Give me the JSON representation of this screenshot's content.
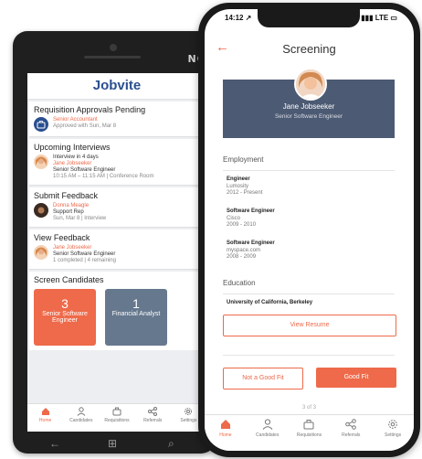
{
  "colors": {
    "accent": "#ee6a4a",
    "brand_blue": "#2a4f91",
    "profile_bg": "#4c5a73",
    "tile_gray": "#66788e"
  },
  "winphone": {
    "brand": "NO",
    "app_title": "Jobvite",
    "cards": [
      {
        "title": "Requisition Approvals Pending",
        "line1": "Senior Accountant",
        "line2": "Approved with Sun, Mar 8"
      },
      {
        "title": "Upcoming Interviews",
        "line1": "Interview in 4 days",
        "line2": "Jane Jobseeker",
        "line3": "Senior Software Engineer",
        "line4": "10:15 AM – 11:15 AM | Conference Room"
      },
      {
        "title": "Submit Feedback",
        "line1": "Donna Meagle",
        "line2": "Support Rep",
        "line3": "Sun, Mar 8 | Interview"
      },
      {
        "title": "View Feedback",
        "line1": "Jane Jobseeker",
        "line2": "Senior Software Engineer",
        "line3": "1 completed | 4 remaining"
      }
    ],
    "screen_candidates": {
      "title": "Screen Candidates",
      "tiles": [
        {
          "count": "3",
          "label": "Senior Software Engineer"
        },
        {
          "count": "1",
          "label": "Financial Analyst"
        }
      ]
    },
    "tabs": [
      "Home",
      "Candidates",
      "Requisitions",
      "Referrals",
      "Settings"
    ],
    "nav": {
      "back": "←",
      "windows": "⊞",
      "search": "⌕"
    }
  },
  "iphone": {
    "status": {
      "time": "14:12 ↗",
      "signal": "▮▮▮ LTE ▭"
    },
    "header": {
      "back_icon": "←",
      "title": "Screening"
    },
    "profile": {
      "name": "Jane Jobseeker",
      "title": "Senior Software Engineer"
    },
    "employment": {
      "heading": "Employment",
      "jobs": [
        {
          "title": "Engineer",
          "company": "Lumosity",
          "dates": "2012 - Present"
        },
        {
          "title": "Software Engineer",
          "company": "Cisco",
          "dates": "2009 - 2010"
        },
        {
          "title": "Software Engineer",
          "company": "myspace.com",
          "dates": "2008 - 2009"
        }
      ]
    },
    "education": {
      "heading": "Education",
      "school": "University of California, Berkeley"
    },
    "view_resume_label": "View Resume",
    "not_fit_label": "Not a Good Fit",
    "good_fit_label": "Good Fit",
    "pager": "3 of 3",
    "tabs": [
      "Home",
      "Candidates",
      "Requisitions",
      "Referrals",
      "Settings"
    ]
  }
}
